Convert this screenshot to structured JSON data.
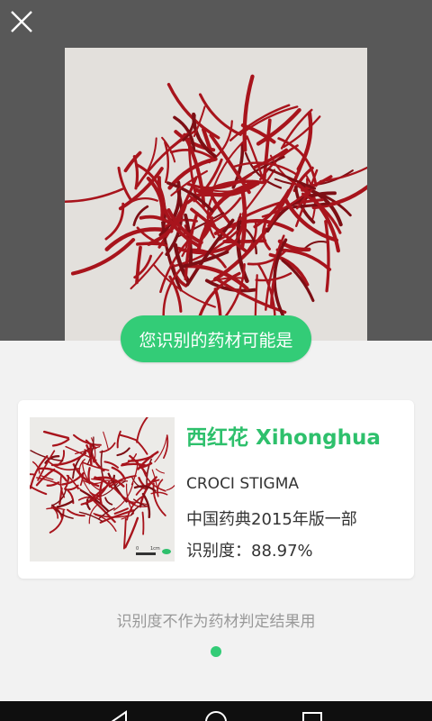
{
  "result": {
    "banner": "您识别的药材可能是",
    "item": {
      "name_cn": "西红花",
      "name_pinyin": "Xihonghua",
      "latin": "CROCI STIGMA",
      "source": "中国药典2015年版一部",
      "score_label": "识别度：",
      "score_value": "88.97%"
    },
    "disclaimer": "识别度不作为药材判定结果用"
  },
  "pager": {
    "count": 1,
    "active": 0
  },
  "thumb_scale": {
    "start": "0",
    "end": "1cm"
  },
  "colors": {
    "accent": "#33cc77",
    "name_green": "#2ec06c",
    "saffron": "#a8141c",
    "top_bg": "#585858"
  },
  "icons": {
    "close": "close-icon",
    "back": "back-icon",
    "home": "home-icon",
    "recents": "recents-icon"
  }
}
